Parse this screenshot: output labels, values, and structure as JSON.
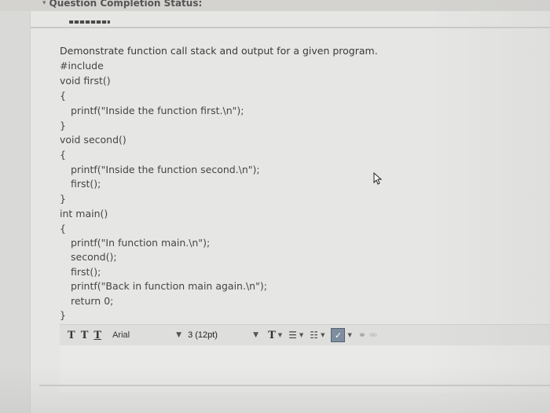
{
  "header": {
    "status_label": "Question Completion Status:"
  },
  "question": {
    "prompt": "Demonstrate function call stack and output for a given program.",
    "code_lines": [
      "#include",
      "void first()",
      "{",
      "printf(\"Inside the function first.\\n\");",
      "}",
      "void second()",
      "{",
      "printf(\"Inside the function second.\\n\");",
      "first();",
      "}",
      "int main()",
      "{",
      "printf(\"In function main.\\n\");",
      "second();",
      "first();",
      "printf(\"Back in function main again.\\n\");",
      "return 0;",
      "}"
    ]
  },
  "toolbar": {
    "text_buttons": [
      "T",
      "T",
      "T"
    ],
    "font_family": "Arial",
    "font_size": "3 (12pt)",
    "format_t": "T"
  },
  "colors": {
    "page_background": "#d9d9d7",
    "panel_background": "#e6e6e4",
    "spellcheck_button": "#7e8ea0"
  }
}
